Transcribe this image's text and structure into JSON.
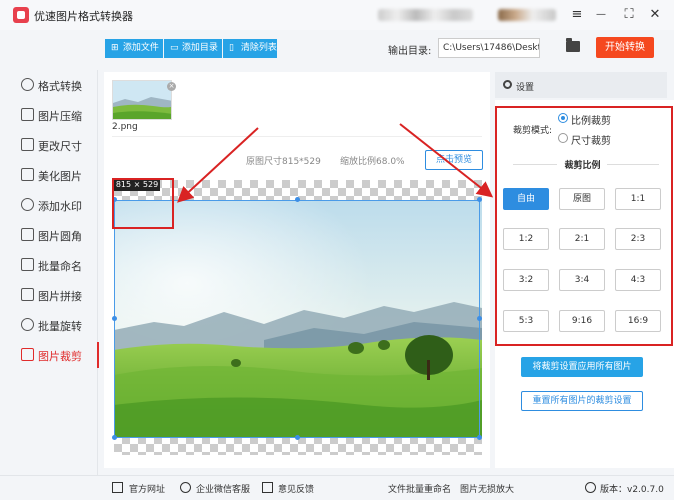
{
  "app": {
    "title": "优速图片格式转换器"
  },
  "window": {
    "menu": "≡",
    "minimize": "—",
    "maximize": "⛶",
    "close": "✕"
  },
  "toolbar": {
    "add_file": "添加文件",
    "add_folder": "添加目录",
    "clear_list": "清除列表",
    "output_label": "输出目录:",
    "output_path": "C:\\Users\\17486\\Deskto",
    "start": "开始转换"
  },
  "sidebar": {
    "items": [
      {
        "label": "格式转换",
        "icon": "format-convert-icon"
      },
      {
        "label": "图片压缩",
        "icon": "compress-icon"
      },
      {
        "label": "更改尺寸",
        "icon": "resize-icon"
      },
      {
        "label": "美化图片",
        "icon": "beautify-icon"
      },
      {
        "label": "添加水印",
        "icon": "watermark-icon"
      },
      {
        "label": "图片圆角",
        "icon": "round-corner-icon"
      },
      {
        "label": "批量命名",
        "icon": "rename-icon"
      },
      {
        "label": "图片拼接",
        "icon": "stitch-icon"
      },
      {
        "label": "批量旋转",
        "icon": "rotate-icon"
      },
      {
        "label": "图片裁剪",
        "icon": "crop-icon",
        "active": true
      }
    ]
  },
  "file": {
    "name": "2.png",
    "close": "×"
  },
  "preview": {
    "original_size": "原图尺寸815*529",
    "zoom": "缩放比例68.0%",
    "preview_button": "点击预览",
    "crop_size_tag": "815 × 529"
  },
  "settings": {
    "header": "设置",
    "mode_label": "裁剪模式:",
    "mode_ratio": "比例裁剪",
    "mode_size": "尺寸裁剪",
    "ratio_title": "裁剪比例",
    "ratios": [
      "自由",
      "原图",
      "1:1",
      "1:2",
      "2:1",
      "2:3",
      "3:2",
      "3:4",
      "4:3",
      "5:3",
      "9:16",
      "16:9"
    ],
    "selected_ratio": "自由",
    "apply_all": "将裁剪设置应用所有图片",
    "reset_all": "重置所有图片的裁剪设置"
  },
  "footer": {
    "website": "官方网址",
    "wechat": "企业微信客服",
    "feedback": "意见反馈",
    "batch_rename": "文件批量重命名",
    "lossless_enlarge": "图片无损放大",
    "version": "版本：v2.0.7.0"
  },
  "colors": {
    "accent": "#27a3e6",
    "start": "#f5481f",
    "highlight": "#d92323"
  }
}
